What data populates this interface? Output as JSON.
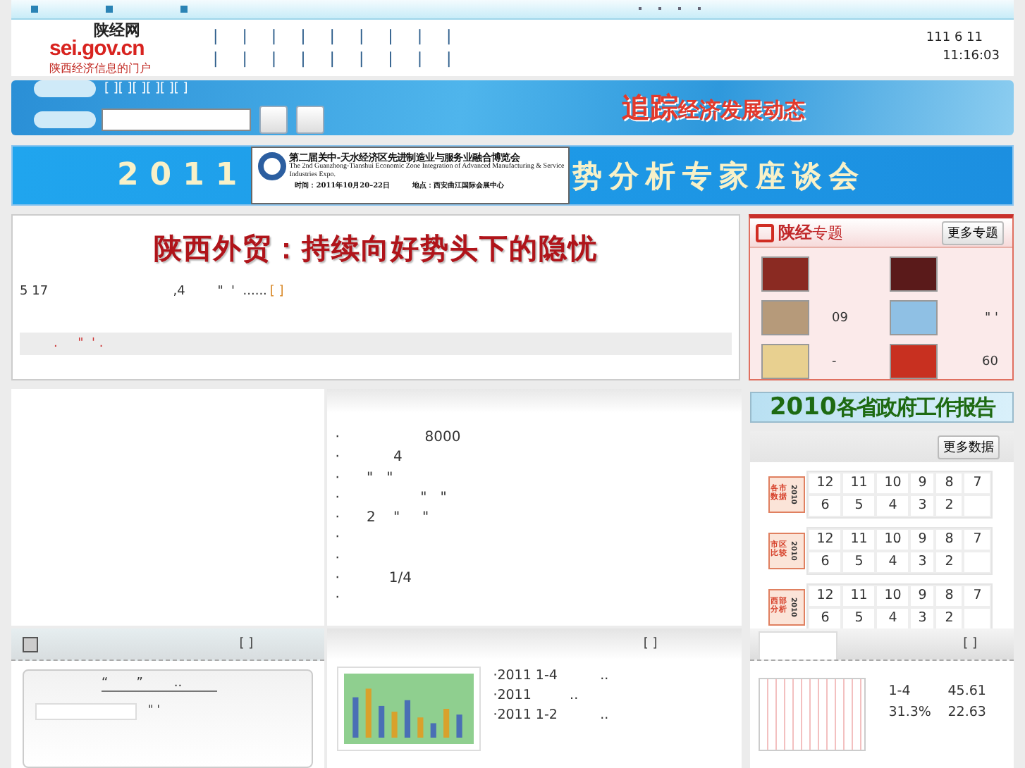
{
  "header": {
    "logo": {
      "name": "陕经网",
      "domain": "sei.gov.cn",
      "tagline": "陕西经济信息的门户"
    },
    "nav_rows": [
      "|    |    |    |    |    |    |    |    |",
      "|    |    |    |    |    |    |    |    |"
    ],
    "date": "111 6 11",
    "time": "11:16:03"
  },
  "search_banner": {
    "links": "[ ][ ][ ][ ][ ][ ]",
    "slogan_strong": "追踪",
    "slogan": "经济发展动态"
  },
  "event_banner": {
    "year": "2011",
    "title": "势分析专家座谈会",
    "ad": {
      "title": "第二届关中-天水经济区先进制造业与服务业融合博览会",
      "subtitle": "The 2nd Guanzhong-Tianshui Economic Zone Integration of Advanced Manufacturing & Service Industries Expo.",
      "time": "时间：2011年10月20–22日",
      "place": "地点：西安曲江国际会展中心"
    }
  },
  "headline": {
    "title": "陕西外贸：持续向好势头下的隐忧",
    "summary": "5 17                               ,4        \"  '  ......",
    "more": "[ ]",
    "ticker": ".     \"  ' ."
  },
  "topics": {
    "brand": "陕经",
    "title": "专题",
    "more": "更多专题",
    "captions": [
      "09",
      "\" '",
      "-",
      "60"
    ]
  },
  "news_list": {
    "items": [
      "·                   8000",
      "·            4",
      "·      \"   \"",
      "·                  \"   \"",
      "·      2    \"     \"",
      "·",
      "·",
      "·           1/4",
      "·"
    ]
  },
  "report_banner": {
    "year": "2010",
    "title": "各省政府工作报告"
  },
  "data_panel": {
    "more": "更多数据",
    "groups": [
      {
        "label": "各市数据",
        "year": "2010",
        "cells": [
          "12",
          "11",
          "10",
          "9",
          "8",
          "7",
          "6",
          "5",
          "4",
          "3",
          "2"
        ]
      },
      {
        "label": "市区比较",
        "year": "2010",
        "cells": [
          "12",
          "11",
          "10",
          "9",
          "8",
          "7",
          "6",
          "5",
          "4",
          "3",
          "2"
        ]
      },
      {
        "label": "西部分析",
        "year": "2010",
        "cells": [
          "12",
          "11",
          "10",
          "9",
          "8",
          "7",
          "6",
          "5",
          "4",
          "3",
          "2"
        ]
      }
    ]
  },
  "bottom_left": {
    "more": "[ ]",
    "quote": "“       ”",
    "dots": "..",
    "caption": "\" '"
  },
  "bottom_middle": {
    "more": "[ ]",
    "items": [
      "·2011 1-4          ..",
      "·2011         ..",
      "·2011 1-2          .."
    ]
  },
  "bottom_right": {
    "more": "[ ]",
    "stats": [
      {
        "label": "1-4",
        "value": "45.61"
      },
      {
        "label": "31.3%",
        "value": "22.63"
      }
    ]
  }
}
